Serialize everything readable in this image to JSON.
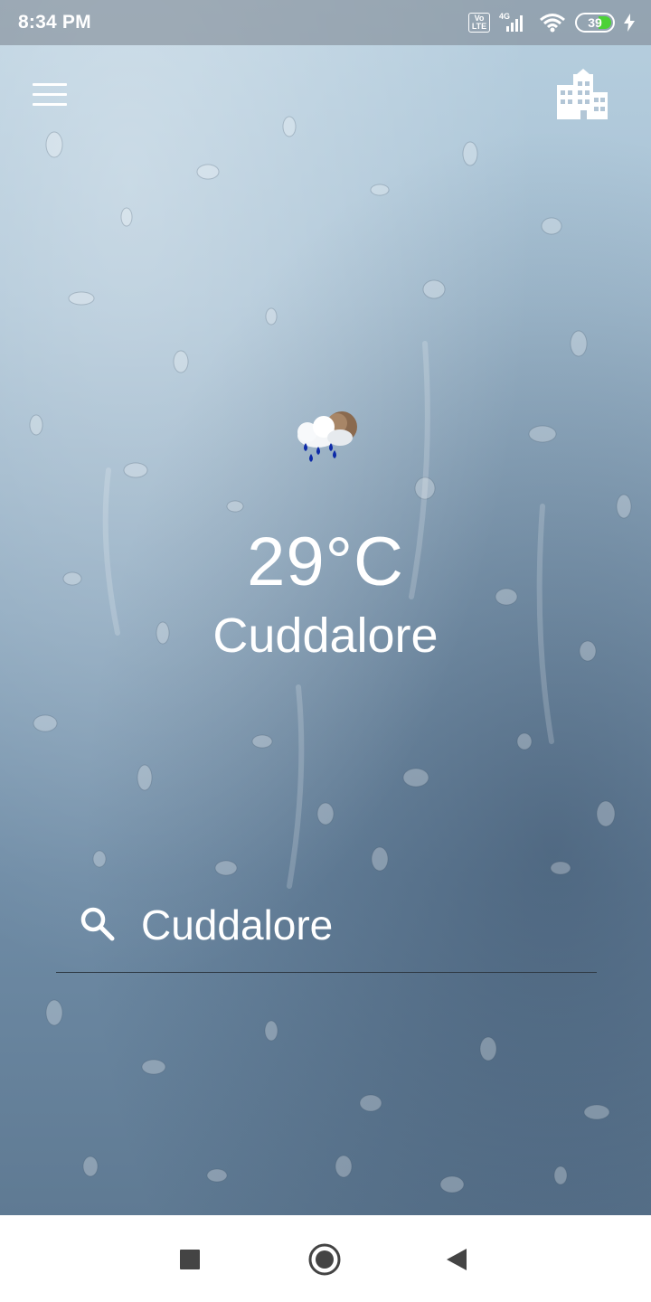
{
  "status_bar": {
    "time": "8:34 PM",
    "volte": "Vo LTE",
    "network": "4G",
    "battery_level": "39",
    "battery_fraction": 0.39,
    "accent_battery": "#4cd137"
  },
  "header": {
    "menu_icon": "hamburger-menu-icon",
    "city_icon": "city-buildings-icon"
  },
  "weather": {
    "condition_icon": "rain-cloud-moon-icon",
    "temperature": "29°C",
    "city": "Cuddalore"
  },
  "search": {
    "icon": "search-icon",
    "value": "Cuddalore"
  },
  "nav_bar": {
    "recents_icon": "square-recents-icon",
    "home_icon": "circle-home-icon",
    "back_icon": "triangle-back-icon"
  }
}
